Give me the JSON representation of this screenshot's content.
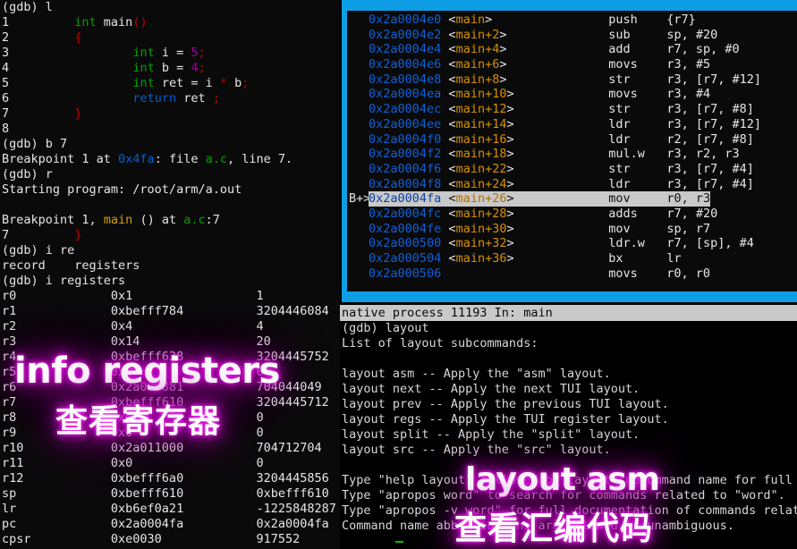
{
  "left_terminal": {
    "lines": [
      {
        "segs": [
          {
            "t": "(gdb) l",
            "c": "c-white"
          }
        ]
      },
      {
        "segs": [
          {
            "t": "1         ",
            "c": "c-white"
          },
          {
            "t": "int",
            "c": "c-green"
          },
          {
            "t": " main",
            "c": "c-white"
          },
          {
            "t": "()",
            "c": "c-red"
          }
        ]
      },
      {
        "segs": [
          {
            "t": "2         ",
            "c": "c-white"
          },
          {
            "t": "{",
            "c": "c-red"
          }
        ]
      },
      {
        "segs": [
          {
            "t": "3                 ",
            "c": "c-white"
          },
          {
            "t": "int",
            "c": "c-green"
          },
          {
            "t": " i = ",
            "c": "c-white"
          },
          {
            "t": "5",
            "c": "c-magenta"
          },
          {
            "t": ";",
            "c": "c-red"
          }
        ]
      },
      {
        "segs": [
          {
            "t": "4                 ",
            "c": "c-white"
          },
          {
            "t": "int",
            "c": "c-green"
          },
          {
            "t": " b = ",
            "c": "c-white"
          },
          {
            "t": "4",
            "c": "c-magenta"
          },
          {
            "t": ";",
            "c": "c-red"
          }
        ]
      },
      {
        "segs": [
          {
            "t": "5                 ",
            "c": "c-white"
          },
          {
            "t": "int",
            "c": "c-green"
          },
          {
            "t": " ret = i ",
            "c": "c-white"
          },
          {
            "t": "*",
            "c": "c-red"
          },
          {
            "t": " b",
            "c": "c-white"
          },
          {
            "t": ";",
            "c": "c-red"
          }
        ]
      },
      {
        "segs": [
          {
            "t": "6                 ",
            "c": "c-white"
          },
          {
            "t": "return",
            "c": "c-blue"
          },
          {
            "t": " ret ",
            "c": "c-white"
          },
          {
            "t": ";",
            "c": "c-red"
          }
        ]
      },
      {
        "segs": [
          {
            "t": "7         ",
            "c": "c-white"
          },
          {
            "t": "}",
            "c": "c-red"
          }
        ]
      },
      {
        "segs": [
          {
            "t": "8",
            "c": "c-white"
          }
        ]
      },
      {
        "segs": [
          {
            "t": "(gdb) b 7",
            "c": "c-white"
          }
        ]
      },
      {
        "segs": [
          {
            "t": "Breakpoint 1 at ",
            "c": "c-white"
          },
          {
            "t": "0x4fa",
            "c": "c-blue"
          },
          {
            "t": ": file ",
            "c": "c-white"
          },
          {
            "t": "a.c",
            "c": "c-green"
          },
          {
            "t": ", line 7.",
            "c": "c-white"
          }
        ]
      },
      {
        "segs": [
          {
            "t": "(gdb) r",
            "c": "c-white"
          }
        ]
      },
      {
        "segs": [
          {
            "t": "Starting program: /root/arm/a.out",
            "c": "c-white"
          }
        ]
      },
      {
        "segs": [
          {
            "t": "",
            "c": "c-white"
          }
        ]
      },
      {
        "segs": [
          {
            "t": "Breakpoint 1, ",
            "c": "c-white"
          },
          {
            "t": "main",
            "c": "c-yellow"
          },
          {
            "t": " () at ",
            "c": "c-white"
          },
          {
            "t": "a.c",
            "c": "c-green"
          },
          {
            "t": ":7",
            "c": "c-white"
          }
        ]
      },
      {
        "segs": [
          {
            "t": "7         ",
            "c": "c-white"
          },
          {
            "t": "}",
            "c": "c-red"
          }
        ]
      },
      {
        "segs": [
          {
            "t": "(gdb) i re",
            "c": "c-white"
          }
        ]
      },
      {
        "segs": [
          {
            "t": "record    registers",
            "c": "c-white"
          }
        ]
      },
      {
        "segs": [
          {
            "t": "(gdb) i registers",
            "c": "c-white"
          }
        ]
      },
      {
        "segs": [
          {
            "t": "r0             0x1                 1",
            "c": "c-white"
          }
        ]
      },
      {
        "segs": [
          {
            "t": "r1             0xbefff784          3204446084",
            "c": "c-white"
          }
        ]
      },
      {
        "segs": [
          {
            "t": "r2             0x4                 4",
            "c": "c-white"
          }
        ]
      },
      {
        "segs": [
          {
            "t": "r3             0x14                20",
            "c": "c-white"
          }
        ]
      },
      {
        "segs": [
          {
            "t": "r4             0xbefff638          3204445752",
            "c": "c-white"
          }
        ]
      },
      {
        "segs": [
          {
            "t": "r5             0x0                 0",
            "c": "c-white"
          }
        ]
      },
      {
        "segs": [
          {
            "t": "r6             0x2a000881          704044049",
            "c": "c-white"
          }
        ]
      },
      {
        "segs": [
          {
            "t": "r7             0xbefff610          3204445712",
            "c": "c-white"
          }
        ]
      },
      {
        "segs": [
          {
            "t": "r8             0x0                 0",
            "c": "c-white"
          }
        ]
      },
      {
        "segs": [
          {
            "t": "r9             0x0                 0",
            "c": "c-white"
          }
        ]
      },
      {
        "segs": [
          {
            "t": "r10            0x2a011000          704712704",
            "c": "c-white"
          }
        ]
      },
      {
        "segs": [
          {
            "t": "r11            0x0                 0",
            "c": "c-white"
          }
        ]
      },
      {
        "segs": [
          {
            "t": "r12            0xbefff6a0          3204445856",
            "c": "c-white"
          }
        ]
      },
      {
        "segs": [
          {
            "t": "sp             0xbefff610          0xbefff610",
            "c": "c-white"
          }
        ]
      },
      {
        "segs": [
          {
            "t": "lr             0xb6ef0a21          -1225848287",
            "c": "c-white"
          }
        ]
      },
      {
        "segs": [
          {
            "t": "pc             0x2a0004fa          0x2a0004fa",
            "c": "c-white"
          }
        ]
      },
      {
        "segs": [
          {
            "t": "cpsr           0xe0030             917552",
            "c": "c-white"
          }
        ]
      }
    ]
  },
  "asm_panel": {
    "rows": [
      {
        "marker": "",
        "addr": "0x2a0004e0",
        "sym": "<main>",
        "mn": "push",
        "ops": "{r7}",
        "current": false
      },
      {
        "marker": "",
        "addr": "0x2a0004e2",
        "sym": "<main+2>",
        "mn": "sub",
        "ops": "sp, #20",
        "current": false
      },
      {
        "marker": "",
        "addr": "0x2a0004e4",
        "sym": "<main+4>",
        "mn": "add",
        "ops": "r7, sp, #0",
        "current": false
      },
      {
        "marker": "",
        "addr": "0x2a0004e6",
        "sym": "<main+6>",
        "mn": "movs",
        "ops": "r3, #5",
        "current": false
      },
      {
        "marker": "",
        "addr": "0x2a0004e8",
        "sym": "<main+8>",
        "mn": "str",
        "ops": "r3, [r7, #12]",
        "current": false
      },
      {
        "marker": "",
        "addr": "0x2a0004ea",
        "sym": "<main+10>",
        "mn": "movs",
        "ops": "r3, #4",
        "current": false
      },
      {
        "marker": "",
        "addr": "0x2a0004ec",
        "sym": "<main+12>",
        "mn": "str",
        "ops": "r3, [r7, #8]",
        "current": false
      },
      {
        "marker": "",
        "addr": "0x2a0004ee",
        "sym": "<main+14>",
        "mn": "ldr",
        "ops": "r3, [r7, #12]",
        "current": false
      },
      {
        "marker": "",
        "addr": "0x2a0004f0",
        "sym": "<main+16>",
        "mn": "ldr",
        "ops": "r2, [r7, #8]",
        "current": false
      },
      {
        "marker": "",
        "addr": "0x2a0004f2",
        "sym": "<main+18>",
        "mn": "mul.w",
        "ops": "r3, r2, r3",
        "current": false
      },
      {
        "marker": "",
        "addr": "0x2a0004f6",
        "sym": "<main+22>",
        "mn": "str",
        "ops": "r3, [r7, #4]",
        "current": false
      },
      {
        "marker": "",
        "addr": "0x2a0004f8",
        "sym": "<main+24>",
        "mn": "ldr",
        "ops": "r3, [r7, #4]",
        "current": false
      },
      {
        "marker": "B+>",
        "addr": "0x2a0004fa",
        "sym": "<main+26>",
        "mn": "mov",
        "ops": "r0, r3",
        "current": true
      },
      {
        "marker": "",
        "addr": "0x2a0004fc",
        "sym": "<main+28>",
        "mn": "adds",
        "ops": "r7, #20",
        "current": false
      },
      {
        "marker": "",
        "addr": "0x2a0004fe",
        "sym": "<main+30>",
        "mn": "mov",
        "ops": "sp, r7",
        "current": false
      },
      {
        "marker": "",
        "addr": "0x2a000500",
        "sym": "<main+32>",
        "mn": "ldr.w",
        "ops": "r7, [sp], #4",
        "current": false
      },
      {
        "marker": "",
        "addr": "0x2a000504",
        "sym": "<main+36>",
        "mn": "bx",
        "ops": "lr",
        "current": false
      },
      {
        "marker": "",
        "addr": "0x2a000506",
        "sym": "",
        "mn": "movs",
        "ops": "r0, r0",
        "current": false
      }
    ]
  },
  "status_bar": {
    "text": "native process 11193 In: main"
  },
  "cmd_output": {
    "lines": [
      "(gdb) layout",
      "List of layout subcommands:",
      "",
      "layout asm -- Apply the \"asm\" layout.",
      "layout next -- Apply the next TUI layout.",
      "layout prev -- Apply the previous TUI layout.",
      "layout regs -- Apply the TUI register layout.",
      "layout split -- Apply the \"split\" layout.",
      "layout src -- Apply the \"src\" layout.",
      "",
      "Type \"help layout\" followed by layout subcommand name for full d",
      "Type \"apropos word\" to search for commands related to \"word\".",
      "Type \"apropos -v word\" for full documentation of commands relate",
      "Command name abbreviations are allowed if unambiguous."
    ]
  },
  "overlay": {
    "en_1": "info registers",
    "zh_1": "查看寄存器",
    "en_2": "layout asm",
    "zh_2": "查看汇编代码",
    "glow_color": "#cc00cc",
    "text_color": "#ffffff"
  }
}
